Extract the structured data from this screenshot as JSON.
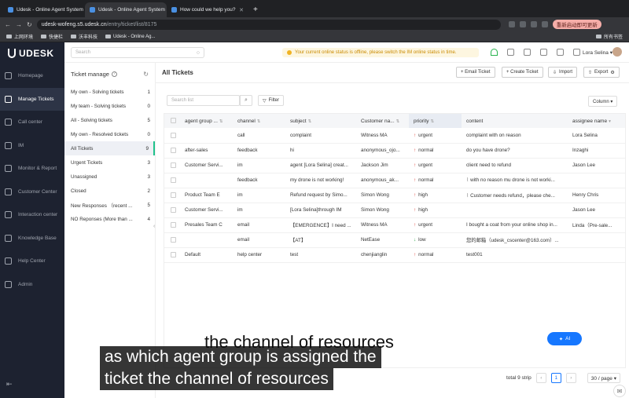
{
  "browser": {
    "tabs": [
      {
        "label": "Udesk - Online Agent System",
        "active": false
      },
      {
        "label": "Udesk - Online Agent System",
        "active": true
      },
      {
        "label": "How could we help you?",
        "active": false
      }
    ],
    "url_host": "udesk-wofeng.s5.udesk.cn",
    "url_path": "/entry/ticket/list/8175",
    "update_label": "重新启动即可更新",
    "bookmarks": [
      "上网环境",
      "快捷栏",
      "沃丰科技",
      "Udesk - Online Ag..."
    ],
    "bookmarks_right": "所有书签"
  },
  "sidebar": {
    "brand": "UDESK",
    "items": [
      {
        "label": "Homepage",
        "icon": "home-icon"
      },
      {
        "label": "Manage Tickets",
        "icon": "ticket-icon",
        "active": true
      },
      {
        "label": "Call center",
        "icon": "phone-icon"
      },
      {
        "label": "IM",
        "icon": "chat-icon"
      },
      {
        "label": "Monitor & Report",
        "icon": "chart-icon"
      },
      {
        "label": "Customer Center",
        "icon": "users-icon"
      },
      {
        "label": "Interaction center",
        "icon": "send-icon"
      },
      {
        "label": "Knowledge Base",
        "icon": "book-icon"
      },
      {
        "label": "Help Center",
        "icon": "help-icon"
      },
      {
        "label": "Admin",
        "icon": "settings-icon"
      }
    ]
  },
  "topbar": {
    "search_placeholder": "Search",
    "notice": "Your current online status is offline, please switch the IM online status in time.",
    "user_name": "Lora Selina ▾"
  },
  "ticket_panel": {
    "title": "Ticket manage",
    "views": [
      {
        "label": "My own - Solving tickets",
        "count": "1"
      },
      {
        "label": "My team - Solving tickets",
        "count": "0"
      },
      {
        "label": "All - Solving tickets",
        "count": "5"
      },
      {
        "label": "My own - Resolved tickets",
        "count": "0"
      },
      {
        "label": "All Tickets",
        "count": "9",
        "active": true
      },
      {
        "label": "Urgent Tickets",
        "count": "3"
      },
      {
        "label": "Unassigned",
        "count": "3"
      },
      {
        "label": "Closed",
        "count": "2"
      },
      {
        "label": "New Responses （recent ...",
        "count": "5"
      },
      {
        "label": "NO Reponses (More than ...",
        "count": "4"
      }
    ]
  },
  "main": {
    "title": "All Tickets",
    "buttons": {
      "email_ticket": "+ Email Ticket",
      "create_ticket": "+ Create Ticket",
      "import": "Import",
      "export": "Export"
    },
    "search_placeholder": "Search list",
    "filter_label": "Filter",
    "column_label": "Column ▾",
    "columns": [
      "agent group ...",
      "channel",
      "subject",
      "Customer na...",
      "priority",
      "content",
      "assignee name"
    ],
    "rows": [
      [
        "",
        "call",
        "complaint",
        "Witness MA",
        "urgent",
        "complaint with on reason",
        "Lora Selina"
      ],
      [
        "after-sales",
        "feedback",
        "hi",
        "anonymous_ojo...",
        "normal",
        "do you have drone?",
        "Inzaghi"
      ],
      [
        "Customer Servi...",
        "im",
        "agent [Lora Selina] creat...",
        "Jackson Jim",
        "urgent",
        "client need to refund",
        "Jason Lee"
      ],
      [
        "",
        "feedback",
        "my drone is not working!",
        "anonymous_ak...",
        "normal",
        "with no reason mu drone is not worki...",
        ""
      ],
      [
        "Product Team E",
        "im",
        "Refund request by Simo...",
        "Simon Wong",
        "high",
        "Customer needs refund，please che...",
        "Henry Chris"
      ],
      [
        "Customer Servi...",
        "im",
        "[Lora Selina]through IM",
        "Simon Wong",
        "high",
        "",
        "Jason Lee"
      ],
      [
        "Presales Team C",
        "email",
        "【EMERGENCE】I need ...",
        "Witness MA",
        "urgent",
        "I bought a coat from your online shop in...",
        "Linda（Pre-sale..."
      ],
      [
        "",
        "email",
        "【AT】",
        "NetEase",
        "low",
        "您的邮箱（udesk_cscenter@163.com）...",
        ""
      ],
      [
        "Default",
        "help center",
        "test",
        "chenjianglin",
        "normal",
        "test001",
        ""
      ]
    ],
    "ai_label": "AI",
    "pager": {
      "total": "total 9 strip",
      "current": "1",
      "page_size": "30 / page ▾"
    }
  },
  "subtitles": {
    "ghost": "the channel of resources",
    "line1": "as which agent group is assigned the",
    "line2": "ticket the channel of resources"
  }
}
